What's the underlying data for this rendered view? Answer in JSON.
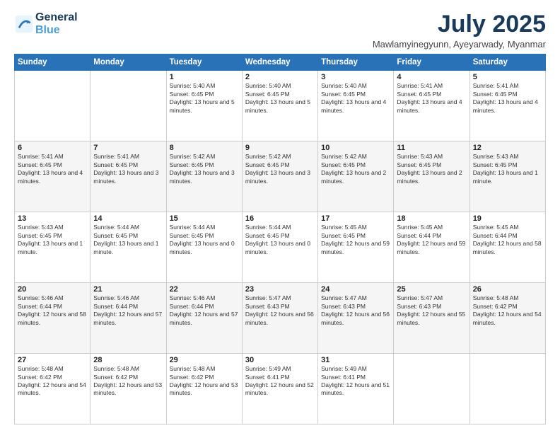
{
  "logo": {
    "line1": "General",
    "line2": "Blue"
  },
  "title": "July 2025",
  "subtitle": "Mawlamyinegyunn, Ayeyarwady, Myanmar",
  "days_of_week": [
    "Sunday",
    "Monday",
    "Tuesday",
    "Wednesday",
    "Thursday",
    "Friday",
    "Saturday"
  ],
  "weeks": [
    [
      {
        "day": "",
        "info": ""
      },
      {
        "day": "",
        "info": ""
      },
      {
        "day": "1",
        "info": "Sunrise: 5:40 AM\nSunset: 6:45 PM\nDaylight: 13 hours and 5 minutes."
      },
      {
        "day": "2",
        "info": "Sunrise: 5:40 AM\nSunset: 6:45 PM\nDaylight: 13 hours and 5 minutes."
      },
      {
        "day": "3",
        "info": "Sunrise: 5:40 AM\nSunset: 6:45 PM\nDaylight: 13 hours and 4 minutes."
      },
      {
        "day": "4",
        "info": "Sunrise: 5:41 AM\nSunset: 6:45 PM\nDaylight: 13 hours and 4 minutes."
      },
      {
        "day": "5",
        "info": "Sunrise: 5:41 AM\nSunset: 6:45 PM\nDaylight: 13 hours and 4 minutes."
      }
    ],
    [
      {
        "day": "6",
        "info": "Sunrise: 5:41 AM\nSunset: 6:45 PM\nDaylight: 13 hours and 4 minutes."
      },
      {
        "day": "7",
        "info": "Sunrise: 5:41 AM\nSunset: 6:45 PM\nDaylight: 13 hours and 3 minutes."
      },
      {
        "day": "8",
        "info": "Sunrise: 5:42 AM\nSunset: 6:45 PM\nDaylight: 13 hours and 3 minutes."
      },
      {
        "day": "9",
        "info": "Sunrise: 5:42 AM\nSunset: 6:45 PM\nDaylight: 13 hours and 3 minutes."
      },
      {
        "day": "10",
        "info": "Sunrise: 5:42 AM\nSunset: 6:45 PM\nDaylight: 13 hours and 2 minutes."
      },
      {
        "day": "11",
        "info": "Sunrise: 5:43 AM\nSunset: 6:45 PM\nDaylight: 13 hours and 2 minutes."
      },
      {
        "day": "12",
        "info": "Sunrise: 5:43 AM\nSunset: 6:45 PM\nDaylight: 13 hours and 1 minute."
      }
    ],
    [
      {
        "day": "13",
        "info": "Sunrise: 5:43 AM\nSunset: 6:45 PM\nDaylight: 13 hours and 1 minute."
      },
      {
        "day": "14",
        "info": "Sunrise: 5:44 AM\nSunset: 6:45 PM\nDaylight: 13 hours and 1 minute."
      },
      {
        "day": "15",
        "info": "Sunrise: 5:44 AM\nSunset: 6:45 PM\nDaylight: 13 hours and 0 minutes."
      },
      {
        "day": "16",
        "info": "Sunrise: 5:44 AM\nSunset: 6:45 PM\nDaylight: 13 hours and 0 minutes."
      },
      {
        "day": "17",
        "info": "Sunrise: 5:45 AM\nSunset: 6:45 PM\nDaylight: 12 hours and 59 minutes."
      },
      {
        "day": "18",
        "info": "Sunrise: 5:45 AM\nSunset: 6:44 PM\nDaylight: 12 hours and 59 minutes."
      },
      {
        "day": "19",
        "info": "Sunrise: 5:45 AM\nSunset: 6:44 PM\nDaylight: 12 hours and 58 minutes."
      }
    ],
    [
      {
        "day": "20",
        "info": "Sunrise: 5:46 AM\nSunset: 6:44 PM\nDaylight: 12 hours and 58 minutes."
      },
      {
        "day": "21",
        "info": "Sunrise: 5:46 AM\nSunset: 6:44 PM\nDaylight: 12 hours and 57 minutes."
      },
      {
        "day": "22",
        "info": "Sunrise: 5:46 AM\nSunset: 6:44 PM\nDaylight: 12 hours and 57 minutes."
      },
      {
        "day": "23",
        "info": "Sunrise: 5:47 AM\nSunset: 6:43 PM\nDaylight: 12 hours and 56 minutes."
      },
      {
        "day": "24",
        "info": "Sunrise: 5:47 AM\nSunset: 6:43 PM\nDaylight: 12 hours and 56 minutes."
      },
      {
        "day": "25",
        "info": "Sunrise: 5:47 AM\nSunset: 6:43 PM\nDaylight: 12 hours and 55 minutes."
      },
      {
        "day": "26",
        "info": "Sunrise: 5:48 AM\nSunset: 6:42 PM\nDaylight: 12 hours and 54 minutes."
      }
    ],
    [
      {
        "day": "27",
        "info": "Sunrise: 5:48 AM\nSunset: 6:42 PM\nDaylight: 12 hours and 54 minutes."
      },
      {
        "day": "28",
        "info": "Sunrise: 5:48 AM\nSunset: 6:42 PM\nDaylight: 12 hours and 53 minutes."
      },
      {
        "day": "29",
        "info": "Sunrise: 5:48 AM\nSunset: 6:42 PM\nDaylight: 12 hours and 53 minutes."
      },
      {
        "day": "30",
        "info": "Sunrise: 5:49 AM\nSunset: 6:41 PM\nDaylight: 12 hours and 52 minutes."
      },
      {
        "day": "31",
        "info": "Sunrise: 5:49 AM\nSunset: 6:41 PM\nDaylight: 12 hours and 51 minutes."
      },
      {
        "day": "",
        "info": ""
      },
      {
        "day": "",
        "info": ""
      }
    ]
  ]
}
